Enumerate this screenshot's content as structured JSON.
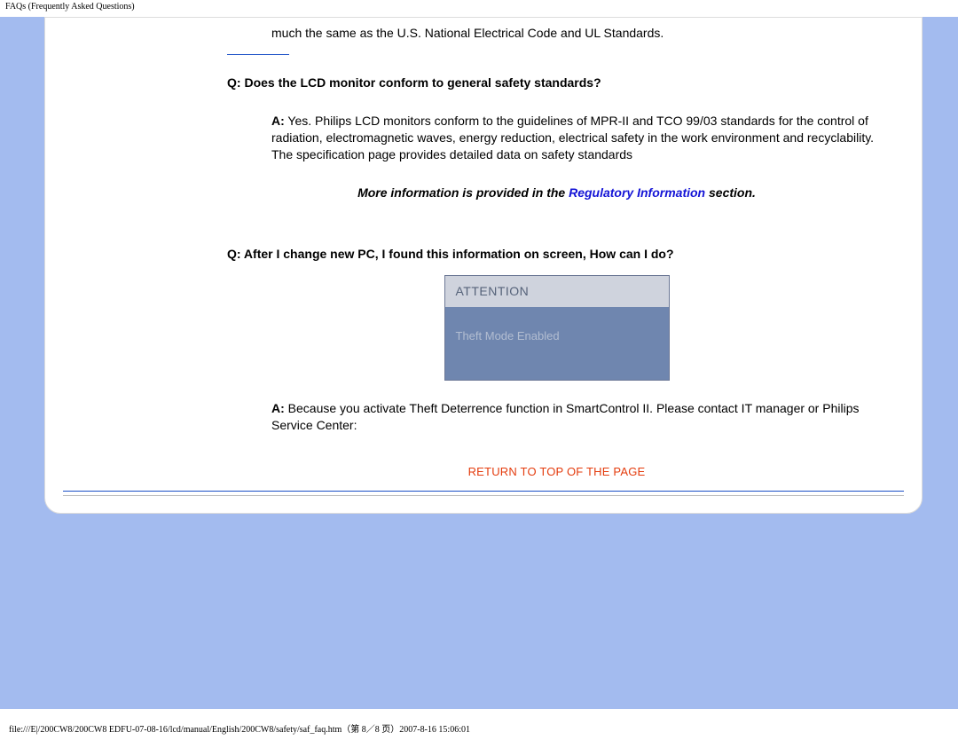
{
  "header": {
    "title": "FAQs (Frequently Asked Questions)"
  },
  "content": {
    "intro_fragment": "much the same as the U.S. National Electrical Code and UL Standards.",
    "q1": {
      "prefix": "Q:",
      "question": " Does the LCD monitor conform to general safety standards?",
      "a_prefix": "A:",
      "answer": " Yes. Philips LCD monitors conform to the guidelines of MPR-II and TCO 99/03 standards for the control of radiation, electromagnetic waves, energy reduction, electrical safety in the work environment and recyclability. The specification page provides detailed data on safety standards"
    },
    "more_info": {
      "before": "More information is provided in the ",
      "link": "Regulatory Information",
      "after": " section."
    },
    "q2": {
      "prefix": "Q:",
      "question": " After I change new PC, I found this information on screen, How can I do?",
      "a_prefix": "A:",
      "answer": " Because you activate Theft Deterrence function in SmartControl II. Please contact IT manager or Philips Service Center:"
    },
    "dialog": {
      "title": "ATTENTION",
      "body": "Theft Mode Enabled"
    },
    "return_link": "RETURN TO TOP OF THE PAGE"
  },
  "footer": {
    "path": "file:///E|/200CW8/200CW8 EDFU-07-08-16/lcd/manual/English/200CW8/safety/saf_faq.htm（第 8／8 页）2007-8-16 15:06:01"
  }
}
